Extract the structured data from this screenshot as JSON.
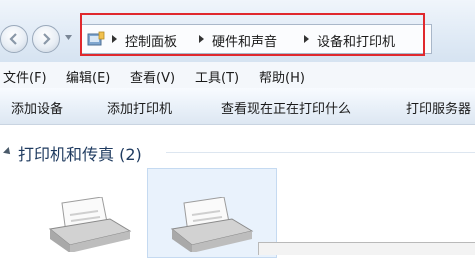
{
  "address_bar": {
    "breadcrumbs": [
      "控制面板",
      "硬件和声音",
      "设备和打印机"
    ]
  },
  "menu": {
    "items": [
      "文件(F)",
      "编辑(E)",
      "查看(V)",
      "工具(T)",
      "帮助(H)"
    ]
  },
  "toolbar": {
    "buttons": [
      "添加设备",
      "添加打印机",
      "查看现在正在打印什么",
      "打印服务器"
    ]
  },
  "content": {
    "group_header": "打印机和传真 (2)"
  },
  "colors": {
    "highlight_border": "#e0282d",
    "group_header_text": "#1e3a5f",
    "selected_tile_bg": "#e9f2fc"
  },
  "icons": [
    "back-arrow-icon",
    "forward-arrow-icon",
    "control-panel-icon",
    "printer-icon"
  ]
}
